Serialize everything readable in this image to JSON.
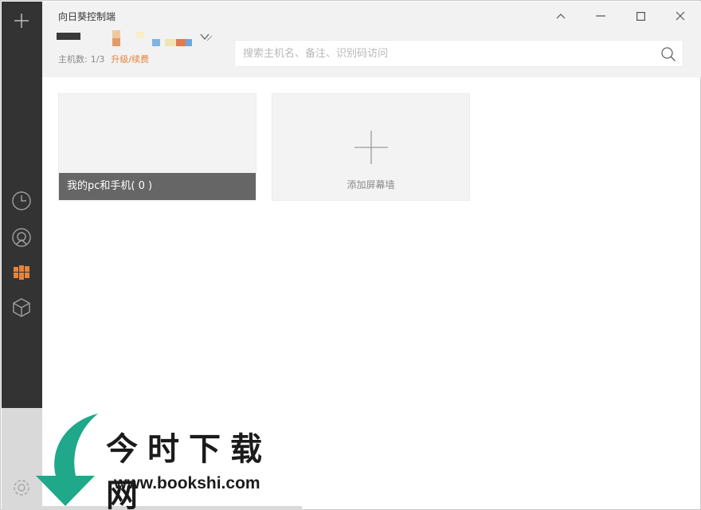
{
  "app": {
    "title": "向日葵控制端"
  },
  "header": {
    "host_count_label": "主机数:",
    "host_count_value": "1/3",
    "upgrade_link": "升级/续费"
  },
  "search": {
    "placeholder": "搜索主机名、备注、识别码访问"
  },
  "cards": {
    "group_label": "我的pc和手机( 0 )",
    "add_label": "添加屏幕墙"
  },
  "sidebar": {
    "items": [
      {
        "icon": "plus-icon"
      },
      {
        "icon": "clock-icon"
      },
      {
        "icon": "remote-icon"
      },
      {
        "icon": "screen-wall-icon",
        "active": true
      },
      {
        "icon": "box-icon"
      },
      {
        "icon": "settings-icon"
      }
    ]
  },
  "colors": {
    "accent": "#e8833a",
    "sidebar": "#333333",
    "card_label_bg": "#666666"
  },
  "watermark": {
    "title": "今时下载网",
    "url": "www.bookshi.com"
  }
}
